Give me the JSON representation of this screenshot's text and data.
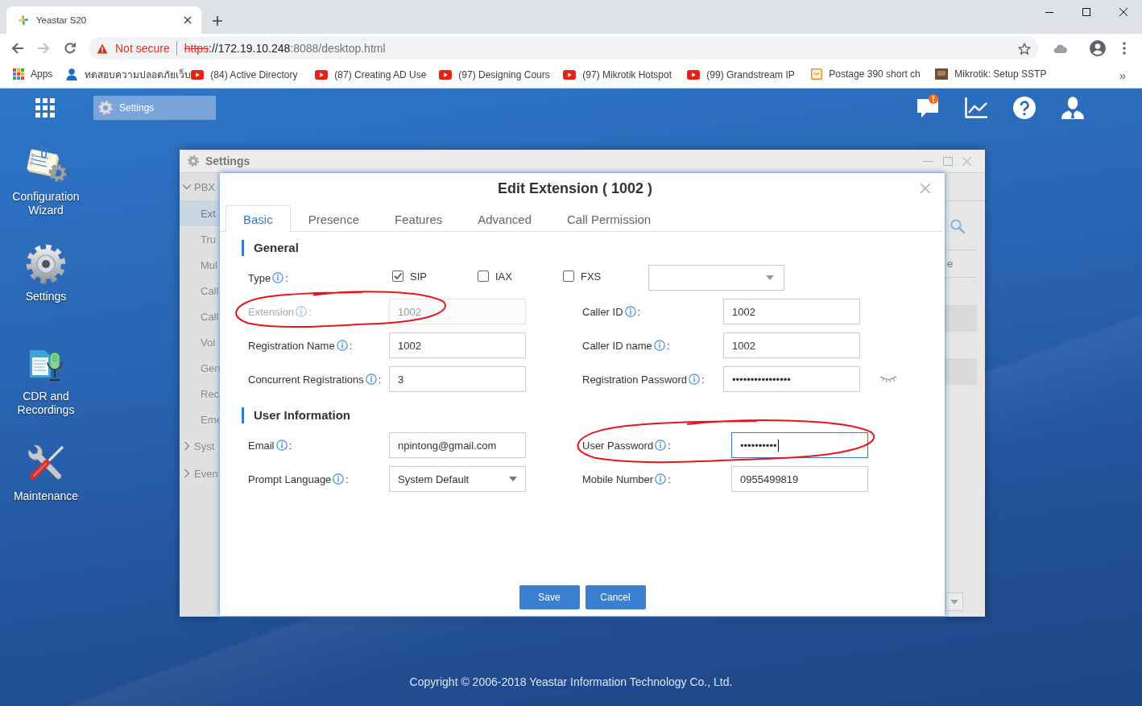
{
  "browser": {
    "tabs": [
      {
        "title": "Yeastar S20",
        "selected": true
      }
    ],
    "address_bar": {
      "security_label": "Not secure",
      "url_scheme": "https",
      "url_host": "://172.19.10.248",
      "url_path": ":8088/desktop.html"
    },
    "bookmarks": [
      {
        "kind": "apps",
        "label": "Apps"
      },
      {
        "kind": "person",
        "label": "ทดสอบความปลอดภัยเว็บ"
      },
      {
        "kind": "video",
        "label": "(84) Active Directory"
      },
      {
        "kind": "video",
        "label": "(87) Creating AD Use"
      },
      {
        "kind": "video",
        "label": "(97) Designing Cours"
      },
      {
        "kind": "video",
        "label": "(97) Mikrotik Hotspot"
      },
      {
        "kind": "video",
        "label": "(99) Grandstream IP"
      },
      {
        "kind": "box",
        "label": "Postage 390 short ch"
      },
      {
        "kind": "thumbnail",
        "label": "Mikrotik: Setup SSTP"
      }
    ],
    "bookmarks_overflow": "»"
  },
  "desktop": {
    "taskbar": [
      {
        "label": "Settings",
        "selected": true
      }
    ],
    "message_alert": true,
    "shortcuts": [
      {
        "kind": "wizard",
        "label": "Configuration Wizard"
      },
      {
        "kind": "settings",
        "label": "Settings"
      },
      {
        "kind": "recordings",
        "label": "CDR and Recordings"
      },
      {
        "kind": "maintenance",
        "label": "Maintenance"
      }
    ],
    "footer": "Copyright © 2006-2018 Yeastar Information Technology Co., Ltd."
  },
  "settings_window": {
    "title": "Settings",
    "nav": [
      {
        "label": "PBX",
        "expanded": true,
        "children": [
          {
            "label": "Ext",
            "selected": true
          },
          {
            "label": "Tru",
            "selected": false
          },
          {
            "label": "Mul",
            "selected": false
          },
          {
            "label": "Call",
            "selected": false
          },
          {
            "label": "Call",
            "selected": false
          },
          {
            "label": "Voi",
            "selected": false
          },
          {
            "label": "Gen",
            "selected": false
          },
          {
            "label": "Rec",
            "selected": false
          },
          {
            "label": "Eme",
            "selected": false
          }
        ]
      },
      {
        "label": "Syst",
        "expanded": false
      },
      {
        "label": "Even",
        "expanded": false
      }
    ],
    "column_3": "e"
  },
  "dialog": {
    "title": "Edit Extension ( 1002 )",
    "tabs": [
      {
        "label": "Basic",
        "selected": true
      },
      {
        "label": "Presence",
        "selected": false
      },
      {
        "label": "Features",
        "selected": false
      },
      {
        "label": "Advanced",
        "selected": false
      },
      {
        "label": "Call Permission",
        "selected": false
      }
    ],
    "sections": [
      {
        "title": "General",
        "rows": [
          [
            {
              "kind": "type",
              "label": "Type",
              "colon": ":",
              "disabled": false,
              "focused": false,
              "circled": false,
              "options": [
                {
                  "label": "SIP",
                  "checked": true
                },
                {
                  "label": "IAX",
                  "checked": false
                },
                {
                  "label": "FXS",
                  "checked": false
                }
              ]
            }
          ],
          [
            {
              "kind": "text",
              "label": "Extension",
              "colon": ":",
              "value": "1002",
              "disabled": true,
              "focused": false,
              "circled": true
            },
            {
              "kind": "text",
              "label": "Caller ID",
              "colon": ":",
              "value": "1002",
              "disabled": false,
              "focused": false,
              "circled": false
            }
          ],
          [
            {
              "kind": "text",
              "label": "Registration Name",
              "colon": ":",
              "value": "1002",
              "disabled": false,
              "focused": false,
              "circled": false
            },
            {
              "kind": "text",
              "label": "Caller ID name",
              "colon": ":",
              "value": "1002",
              "disabled": false,
              "focused": false,
              "circled": false
            }
          ],
          [
            {
              "kind": "text",
              "label": "Concurrent Registrations",
              "colon": ":",
              "value": "3",
              "disabled": false,
              "focused": false,
              "circled": false
            },
            {
              "kind": "password",
              "label": "Registration Password",
              "colon": ":",
              "value": "••••••••••••••••",
              "reveal_toggle": true,
              "disabled": false,
              "focused": false,
              "circled": false
            }
          ]
        ]
      },
      {
        "title": "User Information",
        "rows": [
          [
            {
              "kind": "text",
              "label": "Email",
              "colon": ":",
              "value": "npintong@gmail.com",
              "disabled": false,
              "focused": false,
              "circled": false
            },
            {
              "kind": "password",
              "label": "User Password",
              "colon": ":",
              "value": "••••••••••",
              "reveal_toggle": false,
              "disabled": false,
              "focused": true,
              "circled": true
            }
          ],
          [
            {
              "kind": "select",
              "label": "Prompt Language",
              "colon": ":",
              "value": "System Default",
              "disabled": false,
              "focused": false,
              "circled": false
            },
            {
              "kind": "text",
              "label": "Mobile Number",
              "colon": ":",
              "value": "0955499819",
              "disabled": false,
              "focused": false,
              "circled": false
            }
          ]
        ]
      }
    ],
    "buttons": [
      {
        "label": "Save"
      },
      {
        "label": "Cancel"
      }
    ]
  }
}
